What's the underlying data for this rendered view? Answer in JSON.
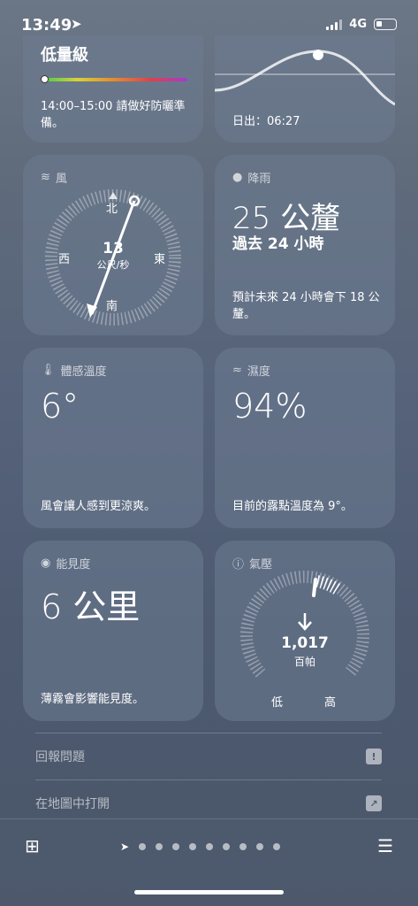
{
  "status": {
    "time": "13:49",
    "network": "4G"
  },
  "uv": {
    "title": "低量級",
    "desc": "14:00–15:00 請做好防曬準備。"
  },
  "sunrise": {
    "desc": "日出：06:27"
  },
  "wind": {
    "title": "風",
    "north": "北",
    "south": "南",
    "east": "東",
    "west": "西",
    "speed": "13",
    "unit": "公尺/秒"
  },
  "rain": {
    "title": "降雨",
    "amount": "25 公釐",
    "period": "過去 24 小時",
    "desc": "預計未來 24 小時會下 18 公釐。"
  },
  "feels": {
    "title": "體感溫度",
    "value": "6°",
    "desc": "風會讓人感到更涼爽。"
  },
  "humidity": {
    "title": "濕度",
    "value": "94%",
    "desc": "目前的露點溫度為 9°。"
  },
  "visibility": {
    "title": "能見度",
    "value": "6 公里",
    "desc": "薄霧會影響能見度。"
  },
  "pressure": {
    "title": "氣壓",
    "value": "1,017",
    "unit": "百帕",
    "low": "低",
    "high": "高"
  },
  "links": {
    "report": "回報問題",
    "open_map": "在地圖中打開"
  },
  "icons": [
    "location-arrow-icon",
    "wind-icon",
    "raindrop-icon",
    "thermometer-icon",
    "humidity-icon",
    "eye-icon",
    "gauge-icon",
    "map-icon",
    "list-icon"
  ]
}
